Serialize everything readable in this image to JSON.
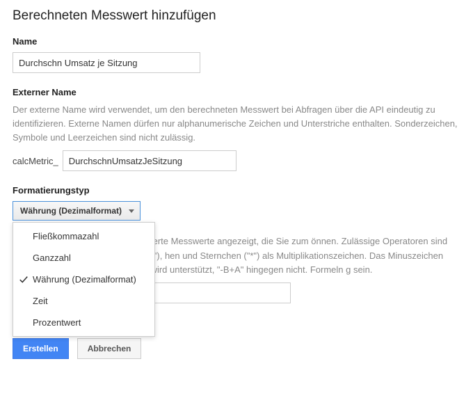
{
  "title": "Berechneten Messwert hinzufügen",
  "name_field": {
    "label": "Name",
    "value": "Durchschn Umsatz je Sitzung"
  },
  "external_name": {
    "label": "Externer Name",
    "help": "Der externe Name wird verwendet, um den berechneten Messwert bei Abfragen über die API eindeutig zu identifizieren. Externe Namen dürfen nur alphanumerische Zeichen und Unterstriche enthalten. Sonderzeichen, Symbole und Leerzeichen sind nicht zulässig.",
    "prefix": "calcMetric_",
    "value": "DurchschnUmsatzJeSitzung"
  },
  "format_type": {
    "label": "Formatierungstyp",
    "selected": "Währung (Dezimalformat)",
    "options": [
      {
        "label": "Fließkommazahl",
        "selected": false
      },
      {
        "label": "Ganzzahl",
        "selected": false
      },
      {
        "label": "Währung (Dezimalformat)",
        "selected": true
      },
      {
        "label": "Zeit",
        "selected": false
      },
      {
        "label": "Prozentwert",
        "selected": false
      }
    ]
  },
  "formula": {
    "help": "n einigen Zeichen werden vordefinierte Messwerte angezeigt, die Sie zum önnen. Zulässige Operatoren sind Pluszeichen (\"+\"), Minuszeichen (\"-\"), hen und Sternchen (\"*\") als Multiplikationszeichen. Das Minuszeichen kann det werden, das heißt, \"A-B\" wird unterstützt, \"-B+A\" hingegen nicht. Formeln g sein.",
    "value": ""
  },
  "buttons": {
    "create": "Erstellen",
    "cancel": "Abbrechen"
  }
}
